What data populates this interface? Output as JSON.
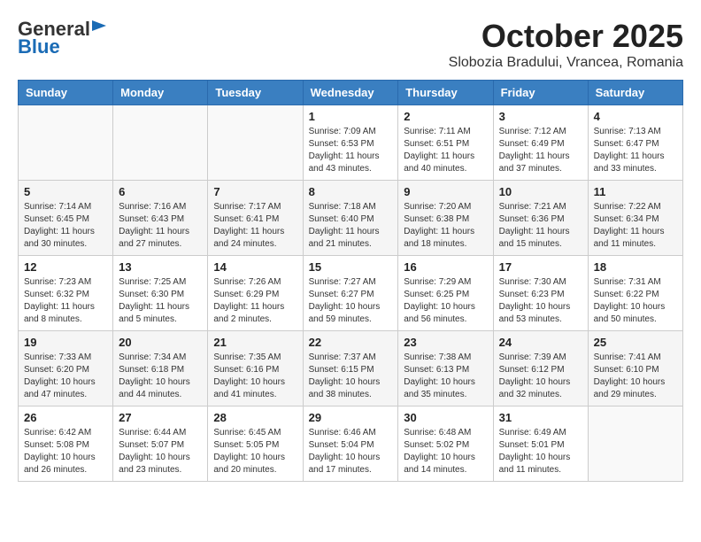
{
  "header": {
    "logo_general": "General",
    "logo_blue": "Blue",
    "month": "October 2025",
    "location": "Slobozia Bradului, Vrancea, Romania"
  },
  "weekdays": [
    "Sunday",
    "Monday",
    "Tuesday",
    "Wednesday",
    "Thursday",
    "Friday",
    "Saturday"
  ],
  "weeks": [
    [
      {
        "day": "",
        "info": ""
      },
      {
        "day": "",
        "info": ""
      },
      {
        "day": "",
        "info": ""
      },
      {
        "day": "1",
        "info": "Sunrise: 7:09 AM\nSunset: 6:53 PM\nDaylight: 11 hours\nand 43 minutes."
      },
      {
        "day": "2",
        "info": "Sunrise: 7:11 AM\nSunset: 6:51 PM\nDaylight: 11 hours\nand 40 minutes."
      },
      {
        "day": "3",
        "info": "Sunrise: 7:12 AM\nSunset: 6:49 PM\nDaylight: 11 hours\nand 37 minutes."
      },
      {
        "day": "4",
        "info": "Sunrise: 7:13 AM\nSunset: 6:47 PM\nDaylight: 11 hours\nand 33 minutes."
      }
    ],
    [
      {
        "day": "5",
        "info": "Sunrise: 7:14 AM\nSunset: 6:45 PM\nDaylight: 11 hours\nand 30 minutes."
      },
      {
        "day": "6",
        "info": "Sunrise: 7:16 AM\nSunset: 6:43 PM\nDaylight: 11 hours\nand 27 minutes."
      },
      {
        "day": "7",
        "info": "Sunrise: 7:17 AM\nSunset: 6:41 PM\nDaylight: 11 hours\nand 24 minutes."
      },
      {
        "day": "8",
        "info": "Sunrise: 7:18 AM\nSunset: 6:40 PM\nDaylight: 11 hours\nand 21 minutes."
      },
      {
        "day": "9",
        "info": "Sunrise: 7:20 AM\nSunset: 6:38 PM\nDaylight: 11 hours\nand 18 minutes."
      },
      {
        "day": "10",
        "info": "Sunrise: 7:21 AM\nSunset: 6:36 PM\nDaylight: 11 hours\nand 15 minutes."
      },
      {
        "day": "11",
        "info": "Sunrise: 7:22 AM\nSunset: 6:34 PM\nDaylight: 11 hours\nand 11 minutes."
      }
    ],
    [
      {
        "day": "12",
        "info": "Sunrise: 7:23 AM\nSunset: 6:32 PM\nDaylight: 11 hours\nand 8 minutes."
      },
      {
        "day": "13",
        "info": "Sunrise: 7:25 AM\nSunset: 6:30 PM\nDaylight: 11 hours\nand 5 minutes."
      },
      {
        "day": "14",
        "info": "Sunrise: 7:26 AM\nSunset: 6:29 PM\nDaylight: 11 hours\nand 2 minutes."
      },
      {
        "day": "15",
        "info": "Sunrise: 7:27 AM\nSunset: 6:27 PM\nDaylight: 10 hours\nand 59 minutes."
      },
      {
        "day": "16",
        "info": "Sunrise: 7:29 AM\nSunset: 6:25 PM\nDaylight: 10 hours\nand 56 minutes."
      },
      {
        "day": "17",
        "info": "Sunrise: 7:30 AM\nSunset: 6:23 PM\nDaylight: 10 hours\nand 53 minutes."
      },
      {
        "day": "18",
        "info": "Sunrise: 7:31 AM\nSunset: 6:22 PM\nDaylight: 10 hours\nand 50 minutes."
      }
    ],
    [
      {
        "day": "19",
        "info": "Sunrise: 7:33 AM\nSunset: 6:20 PM\nDaylight: 10 hours\nand 47 minutes."
      },
      {
        "day": "20",
        "info": "Sunrise: 7:34 AM\nSunset: 6:18 PM\nDaylight: 10 hours\nand 44 minutes."
      },
      {
        "day": "21",
        "info": "Sunrise: 7:35 AM\nSunset: 6:16 PM\nDaylight: 10 hours\nand 41 minutes."
      },
      {
        "day": "22",
        "info": "Sunrise: 7:37 AM\nSunset: 6:15 PM\nDaylight: 10 hours\nand 38 minutes."
      },
      {
        "day": "23",
        "info": "Sunrise: 7:38 AM\nSunset: 6:13 PM\nDaylight: 10 hours\nand 35 minutes."
      },
      {
        "day": "24",
        "info": "Sunrise: 7:39 AM\nSunset: 6:12 PM\nDaylight: 10 hours\nand 32 minutes."
      },
      {
        "day": "25",
        "info": "Sunrise: 7:41 AM\nSunset: 6:10 PM\nDaylight: 10 hours\nand 29 minutes."
      }
    ],
    [
      {
        "day": "26",
        "info": "Sunrise: 6:42 AM\nSunset: 5:08 PM\nDaylight: 10 hours\nand 26 minutes."
      },
      {
        "day": "27",
        "info": "Sunrise: 6:44 AM\nSunset: 5:07 PM\nDaylight: 10 hours\nand 23 minutes."
      },
      {
        "day": "28",
        "info": "Sunrise: 6:45 AM\nSunset: 5:05 PM\nDaylight: 10 hours\nand 20 minutes."
      },
      {
        "day": "29",
        "info": "Sunrise: 6:46 AM\nSunset: 5:04 PM\nDaylight: 10 hours\nand 17 minutes."
      },
      {
        "day": "30",
        "info": "Sunrise: 6:48 AM\nSunset: 5:02 PM\nDaylight: 10 hours\nand 14 minutes."
      },
      {
        "day": "31",
        "info": "Sunrise: 6:49 AM\nSunset: 5:01 PM\nDaylight: 10 hours\nand 11 minutes."
      },
      {
        "day": "",
        "info": ""
      }
    ]
  ]
}
